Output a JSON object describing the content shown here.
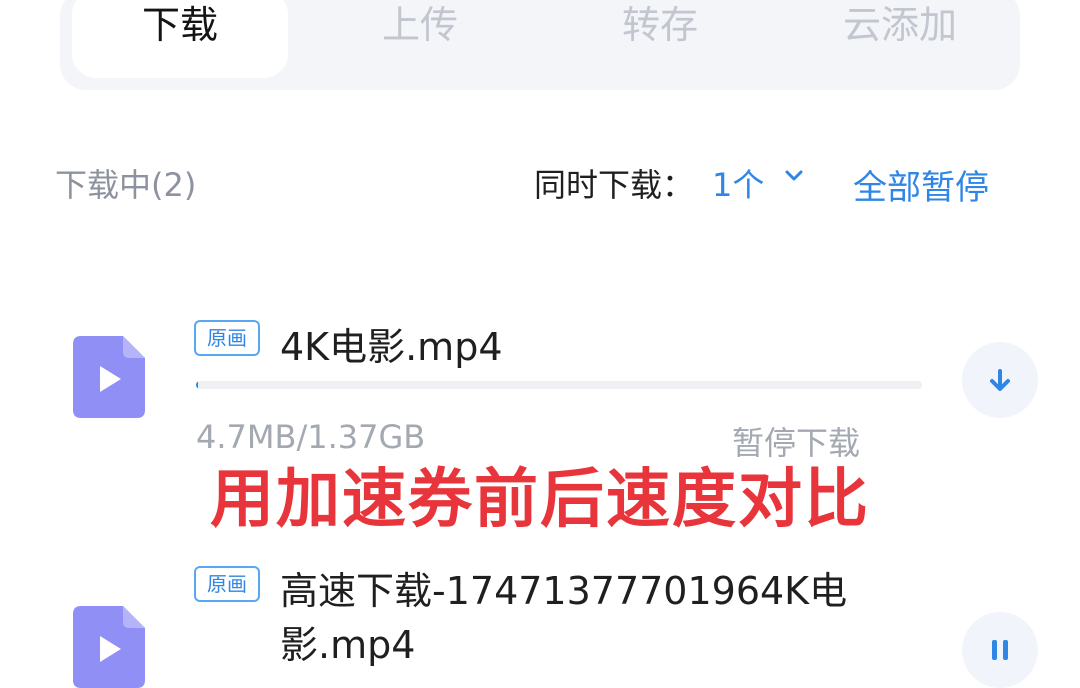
{
  "tabs": [
    {
      "label": "下载"
    },
    {
      "label": "上传"
    },
    {
      "label": "转存"
    },
    {
      "label": "云添加"
    }
  ],
  "section": {
    "title": "下载中(2)",
    "concurrent_label": "同时下载：",
    "concurrent_value": "1个",
    "pause_all": "全部暂停"
  },
  "files": [
    {
      "badge": "原画",
      "name": "4K电影.mp4",
      "size": "4.7MB/1.37GB",
      "status": "暂停下载",
      "progress": 0.0034,
      "action_icon": "download-arrow-icon"
    },
    {
      "badge": "原画",
      "name": "高速下载-17471377701964K电影.mp4",
      "name_line1": "高速下载-17471377701964K电",
      "name_line2": "影.mp4",
      "action_icon": "pause-icon"
    }
  ],
  "overlay_caption": "用加速券前后速度对比",
  "colors": {
    "accent": "#2f86e5",
    "file_icon": "#8f8ff5",
    "overlay_red": "#e8353b",
    "muted": "#a3a8b1"
  }
}
